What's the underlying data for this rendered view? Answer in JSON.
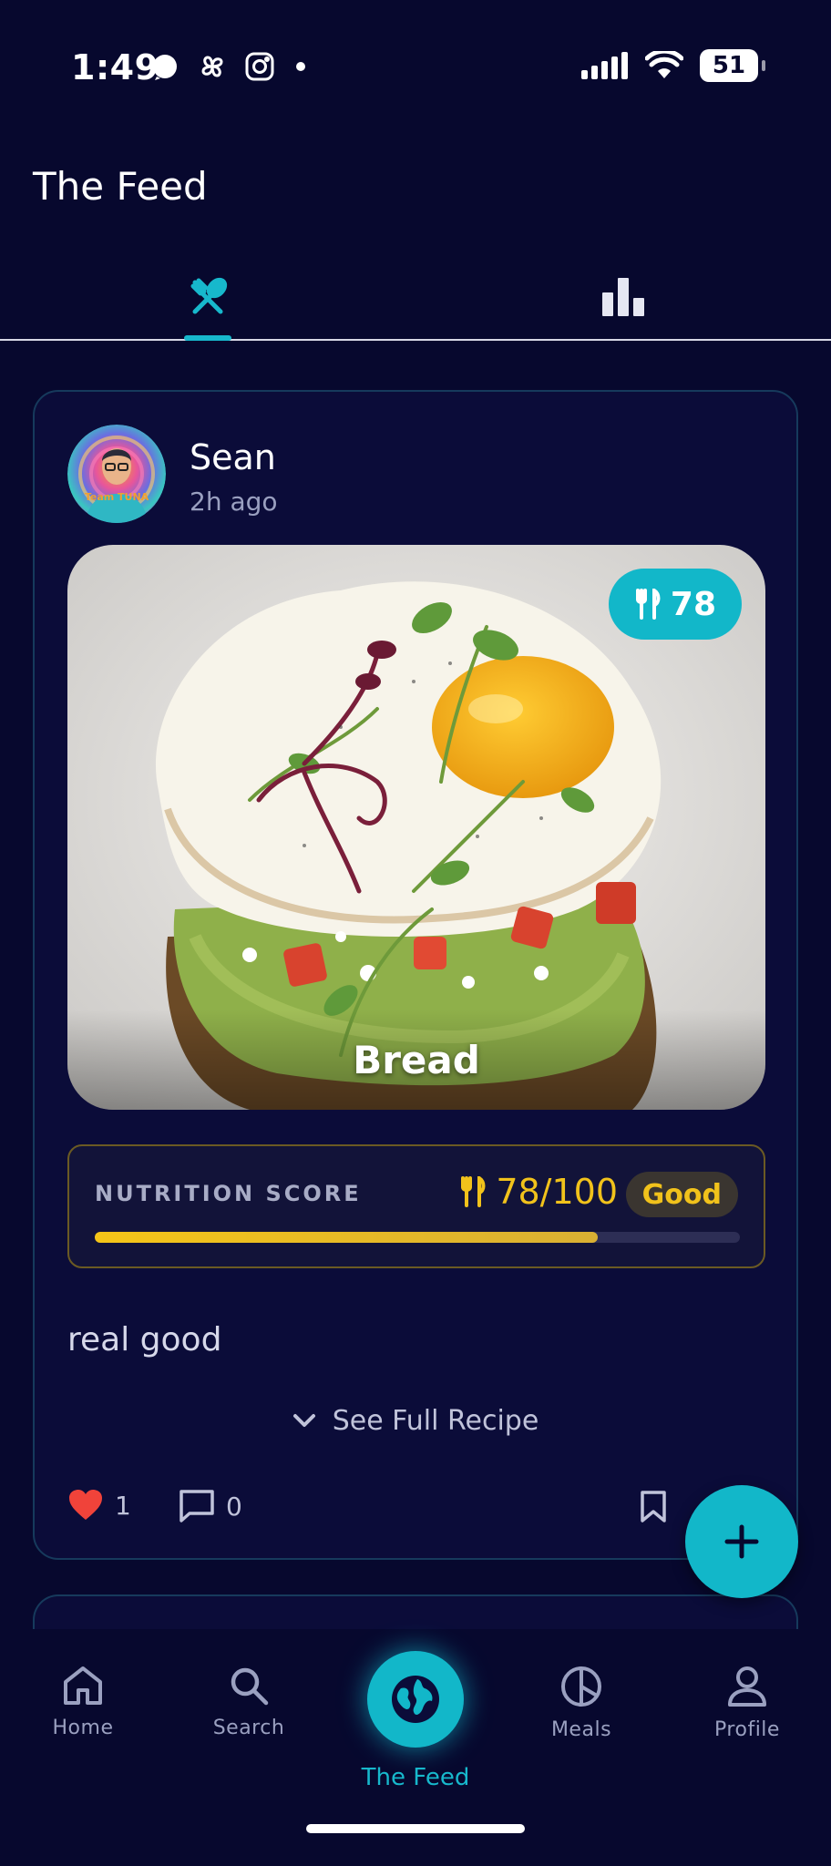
{
  "status_bar": {
    "time": "1:49",
    "battery": "51",
    "icons": [
      "signal-app-icon",
      "pinwheel-icon",
      "instagram-icon",
      "dot-icon",
      "cellular-icon",
      "wifi-icon",
      "battery-icon"
    ]
  },
  "header": {
    "title": "The Feed"
  },
  "tabs": [
    {
      "icon": "utensils-icon",
      "active": true
    },
    {
      "icon": "bar-chart-icon",
      "active": false
    }
  ],
  "post": {
    "user": {
      "name": "Sean",
      "posted": "2h ago",
      "avatar_text": "Team TUNA"
    },
    "photo": {
      "caption": "Bread",
      "score_badge": "78"
    },
    "nutrition": {
      "label": "NUTRITION SCORE",
      "score": "78/100",
      "score_fraction": 0.78,
      "grade": "Good"
    },
    "text": "real good",
    "recipe_toggle": "See Full Recipe",
    "likes": "1",
    "comments": "0"
  },
  "colors": {
    "background": "#07082e",
    "card": "#0b0c39",
    "accent": "#12b7c9",
    "score_gold": "#f1c21b",
    "like_red": "#f0433a"
  },
  "bottom_nav": [
    {
      "label": "Home",
      "icon": "home-icon"
    },
    {
      "label": "Search",
      "icon": "search-icon"
    },
    {
      "label": "The Feed",
      "icon": "globe-icon",
      "active": true
    },
    {
      "label": "Meals",
      "icon": "pie-chart-icon"
    },
    {
      "label": "Profile",
      "icon": "person-icon"
    }
  ]
}
